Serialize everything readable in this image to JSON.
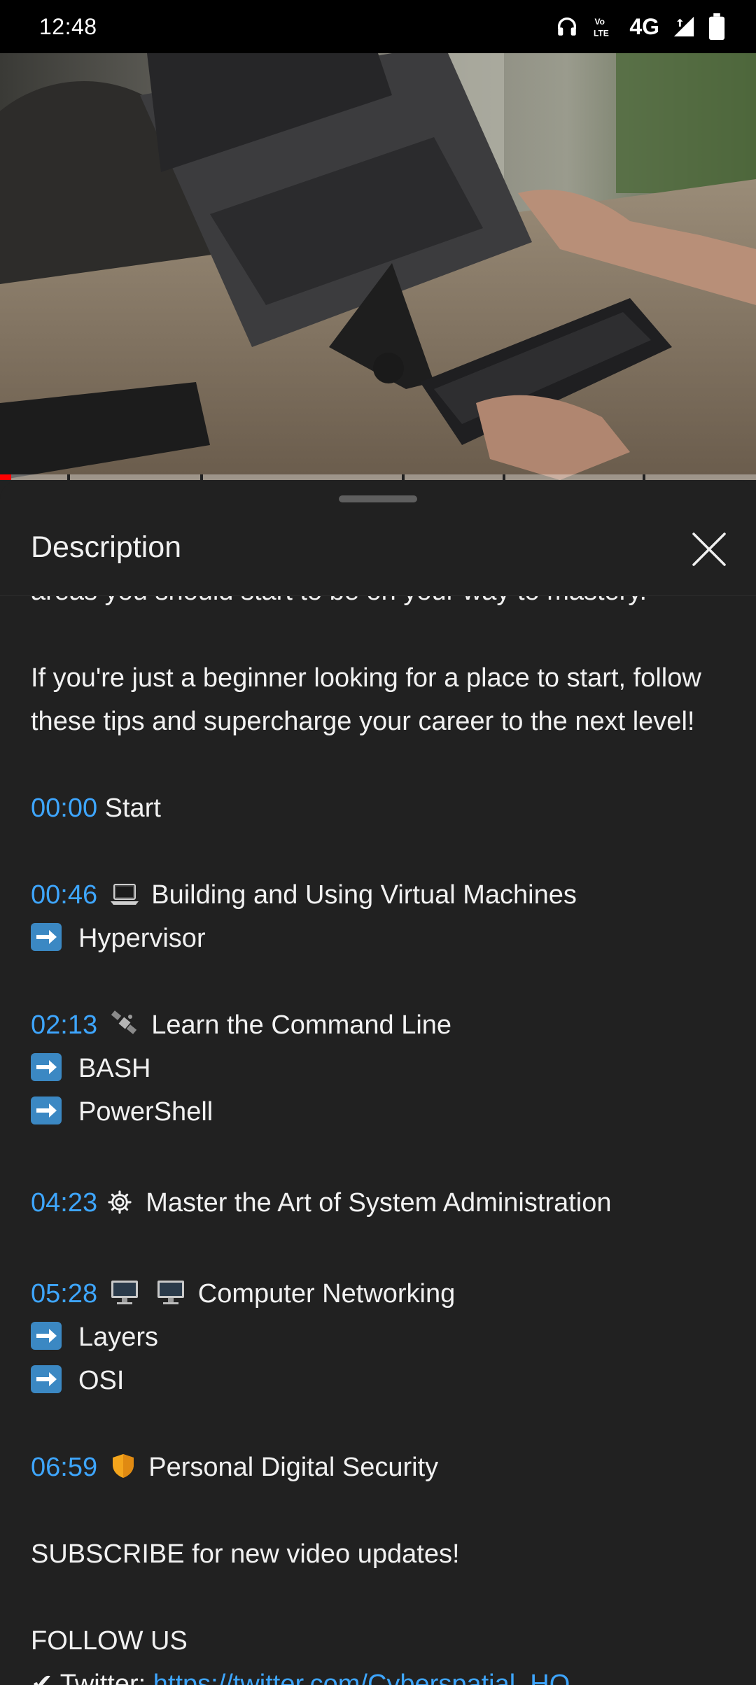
{
  "status_bar": {
    "time": "12:48",
    "network": "4G",
    "icons": [
      "headphones-icon",
      "volte-icon",
      "signal-icon",
      "battery-icon"
    ]
  },
  "video": {
    "progress_fraction": 0.015,
    "progress_color": "#ff0000"
  },
  "sheet": {
    "title": "Description",
    "close_icon": "close-icon"
  },
  "description": {
    "partial_line": "areas you should start to be on your way to mastery.",
    "intro_line1": "If you're just a beginner looking for a place to start, follow",
    "intro_line2": "these tips and supercharge your career to the next level!",
    "chapters": [
      {
        "timestamp": "00:00",
        "title": "Start",
        "subitems": []
      },
      {
        "timestamp": "00:46",
        "icon": "laptop-icon",
        "title": "Building and Using Virtual Machines",
        "subitems": [
          "Hypervisor"
        ]
      },
      {
        "timestamp": "02:13",
        "icon": "satellite-icon",
        "title": "Learn the Command Line",
        "subitems": [
          "BASH",
          "PowerShell"
        ]
      },
      {
        "timestamp": "04:23",
        "icon": "gear-icon",
        "title": "Master the Art of System Administration",
        "subitems": []
      },
      {
        "timestamp": "05:28",
        "icon": "desktop-computer-icon",
        "title": "Computer Networking",
        "subitems": [
          "Layers",
          "OSI"
        ]
      },
      {
        "timestamp": "06:59",
        "icon": "shield-icon",
        "title": "Personal Digital Security",
        "subitems": []
      }
    ],
    "subscribe": "SUBSCRIBE for new video updates!",
    "follow": "FOLLOW US",
    "twitter_label": "Twitter:",
    "twitter_url": "https://twitter.com/Cyberspatial_HQ"
  },
  "colors": {
    "accent_link": "#3ea6ff",
    "sheet_bg": "#212121",
    "arrow_emoji_bg": "#3b88c3"
  }
}
